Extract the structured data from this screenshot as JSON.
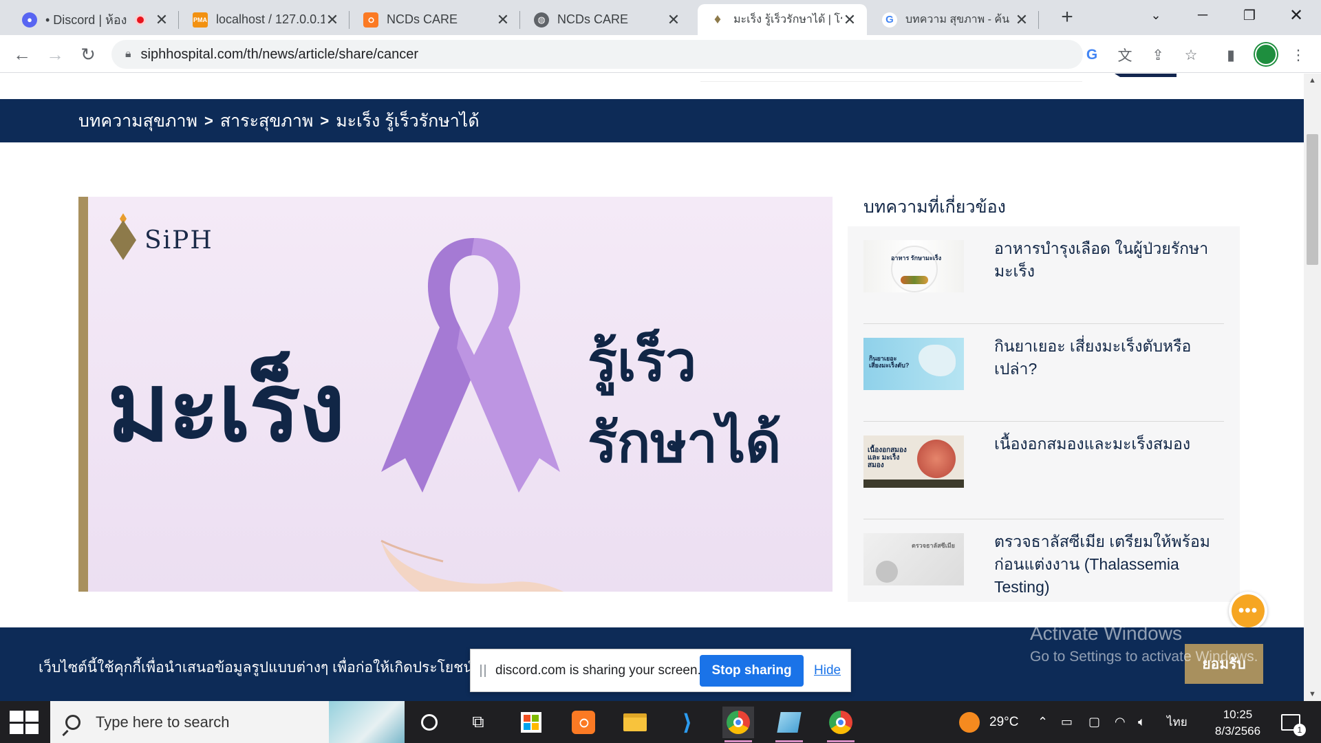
{
  "browser": {
    "tabs": [
      {
        "title": "• Discord | ห้อง",
        "favicon": "discord-icon",
        "recording": true
      },
      {
        "title": "localhost / 127.0.0.1",
        "favicon": "phpmyadmin-icon"
      },
      {
        "title": "NCDs CARE",
        "favicon": "xampp-icon"
      },
      {
        "title": "NCDs CARE",
        "favicon": "globe-icon"
      },
      {
        "title": "มะเร็ง รู้เร็วรักษาได้ | โร",
        "favicon": "siph-icon",
        "active": true
      },
      {
        "title": "บทความ สุขภาพ - ค้น",
        "favicon": "google-icon"
      }
    ],
    "url": "siphhospital.com/th/news/article/share/cancer"
  },
  "page": {
    "breadcrumb": {
      "item1": "บทความสุขภาพ",
      "sep1": ">",
      "item2": "สาระสุขภาพ",
      "sep2": ">",
      "item3": "มะเร็ง รู้เร็วรักษาได้"
    },
    "hero": {
      "brand": "SiPH",
      "headline": "มะเร็ง",
      "tagline_line1": "รู้เร็ว",
      "tagline_line2": "รักษาได้",
      "ribbon_color": "#b58ad8"
    },
    "related": {
      "title": "บทความที่เกี่ยวข้อง",
      "items": [
        {
          "title": "อาหารบำรุงเลือด ในผู้ป่วยรักษามะเร็ง",
          "thumb_text": "อาหาร รักษามะเร็ง"
        },
        {
          "title": "กินยาเยอะ เสี่ยงมะเร็งตับหรือเปล่า?",
          "thumb_text": "กินยาเยอะ เสี่ยงมะเร็งตับ?"
        },
        {
          "title": "เนื้องอกสมองและมะเร็งสมอง",
          "thumb_text": "เนื้องอกสมอง และ มะเร็งสมอง"
        },
        {
          "title": "ตรวจธาลัสซีเมีย เตรียมให้พร้อมก่อนแต่งงาน (Thalassemia Testing)",
          "thumb_text": "ตรวจธาลัสซีเมีย"
        }
      ]
    },
    "cookie": {
      "message": "เว็บไซต์นี้ใช้คุกกี้เพื่อนำเสนอข้อมูลรูปแบบต่างๆ เพื่อก่อให้เกิดประโยชน์",
      "accept_label": "ยอมรับ"
    }
  },
  "watermark": {
    "line1": "Activate Windows",
    "line2": "Go to Settings to activate Windows."
  },
  "share_banner": {
    "message": "discord.com is sharing your screen.",
    "stop_label": "Stop sharing",
    "hide_label": "Hide"
  },
  "taskbar": {
    "search_placeholder": "Type here to search",
    "weather": "29°C",
    "language": "ไทย",
    "time": "10:25",
    "date": "8/3/2566",
    "notification_count": "1"
  },
  "colors": {
    "navy": "#0d2b57",
    "gold": "#a8905e",
    "orange": "#f6a623",
    "link_blue": "#1a73e8"
  }
}
